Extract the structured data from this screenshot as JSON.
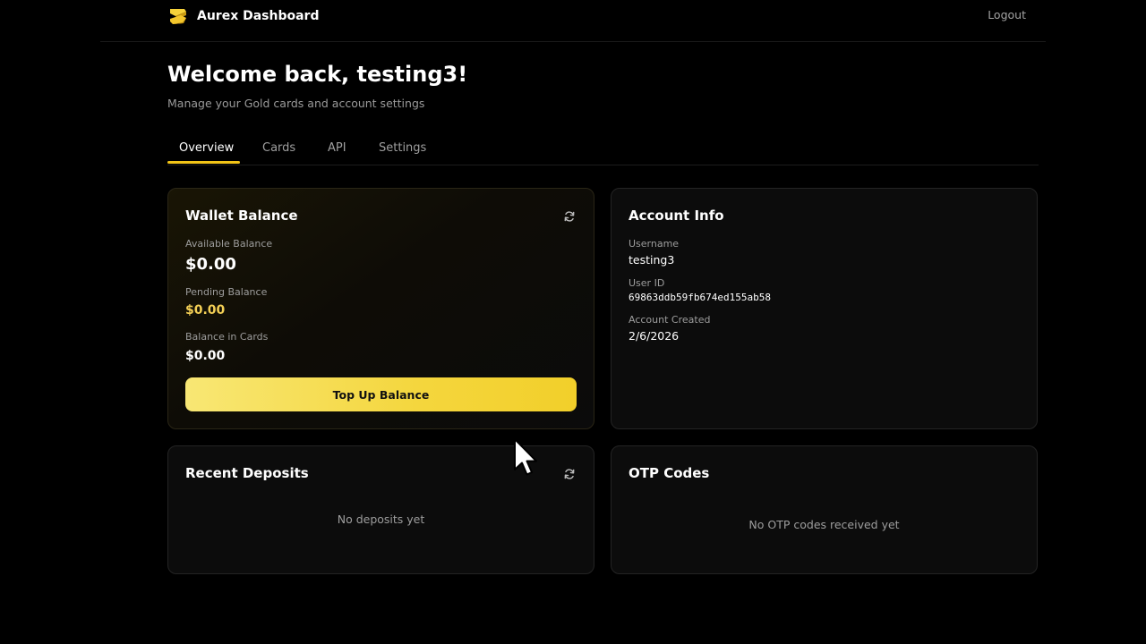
{
  "header": {
    "brand_name": "Aurex Dashboard",
    "logo_icon": "aurex-logo-icon",
    "logout_label": "Logout"
  },
  "welcome": {
    "title": "Welcome back, testing3!",
    "subtitle": "Manage your Gold cards and account settings"
  },
  "tabs": [
    {
      "label": "Overview",
      "active": true
    },
    {
      "label": "Cards",
      "active": false
    },
    {
      "label": "API",
      "active": false
    },
    {
      "label": "Settings",
      "active": false
    }
  ],
  "wallet": {
    "title": "Wallet Balance",
    "refresh_icon": "refresh-icon",
    "available_label": "Available Balance",
    "available_value": "$0.00",
    "pending_label": "Pending Balance",
    "pending_value": "$0.00",
    "cards_label": "Balance in Cards",
    "cards_value": "$0.00",
    "topup_label": "Top Up Balance"
  },
  "account": {
    "title": "Account Info",
    "username_label": "Username",
    "username_value": "testing3",
    "userid_label": "User ID",
    "userid_value": "69863ddb59fb674ed155ab58",
    "created_label": "Account Created",
    "created_value": "2/6/2026"
  },
  "deposits": {
    "title": "Recent Deposits",
    "refresh_icon": "refresh-icon",
    "empty_text": "No deposits yet"
  },
  "otp": {
    "title": "OTP Codes",
    "empty_text": "No OTP codes received yet"
  },
  "colors": {
    "accent": "#f2c417",
    "pending_value": "#f3cf55",
    "background": "#000000",
    "card_background": "#0c0c0c"
  }
}
